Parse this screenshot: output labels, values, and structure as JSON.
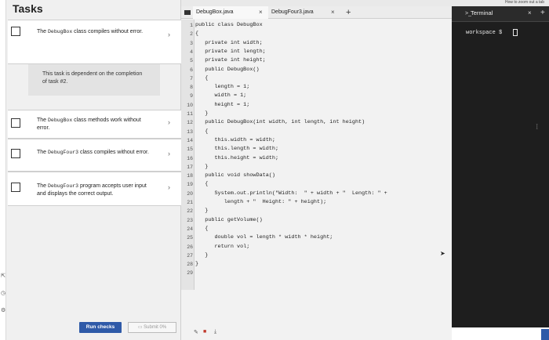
{
  "top_hint": "How to zoom out a tab",
  "tasks_panel": {
    "title": "Tasks",
    "tasks": [
      {
        "pre": "The ",
        "code": "DebugBox",
        "post": " class compiles without error."
      },
      {
        "pre": "The ",
        "code": "DebugBox",
        "post": " class methods work without error."
      },
      {
        "pre": "The ",
        "code": "DebugFour3",
        "post": " class compiles without error."
      },
      {
        "pre": "The ",
        "code": "DebugFour3",
        "post": " program accepts user input and displays the correct output."
      }
    ],
    "dependency_note": "This task is dependent on the completion of task #2.",
    "run_label": "Run checks",
    "submit_label": "Submit 0%"
  },
  "editor": {
    "tabs": [
      "DebugBox.java",
      "DebugFour3.java"
    ],
    "code_lines": [
      "public class DebugBox",
      "{",
      "   private int width;",
      "   private int length;",
      "   private int height;",
      "   public DebugBox()",
      "   {",
      "      length = 1;",
      "      width = 1;",
      "      height = 1;",
      "   }",
      "   public DebugBox(int width, int length, int height)",
      "   {",
      "      this.width = width;",
      "      this.length = width;",
      "      this.height = width;",
      "   }",
      "   public void showData()",
      "   {",
      "      System.out.println(\"Width:  \" + width + \"  Length: \" +",
      "         length + \"  Height: \" + height);",
      "   }",
      "   public getVolume()",
      "   {",
      "      double vol = length * width * height;",
      "      return vol;",
      "   }",
      "}",
      ""
    ]
  },
  "terminal": {
    "tab_label": "Terminal",
    "prompt": "workspace $"
  }
}
